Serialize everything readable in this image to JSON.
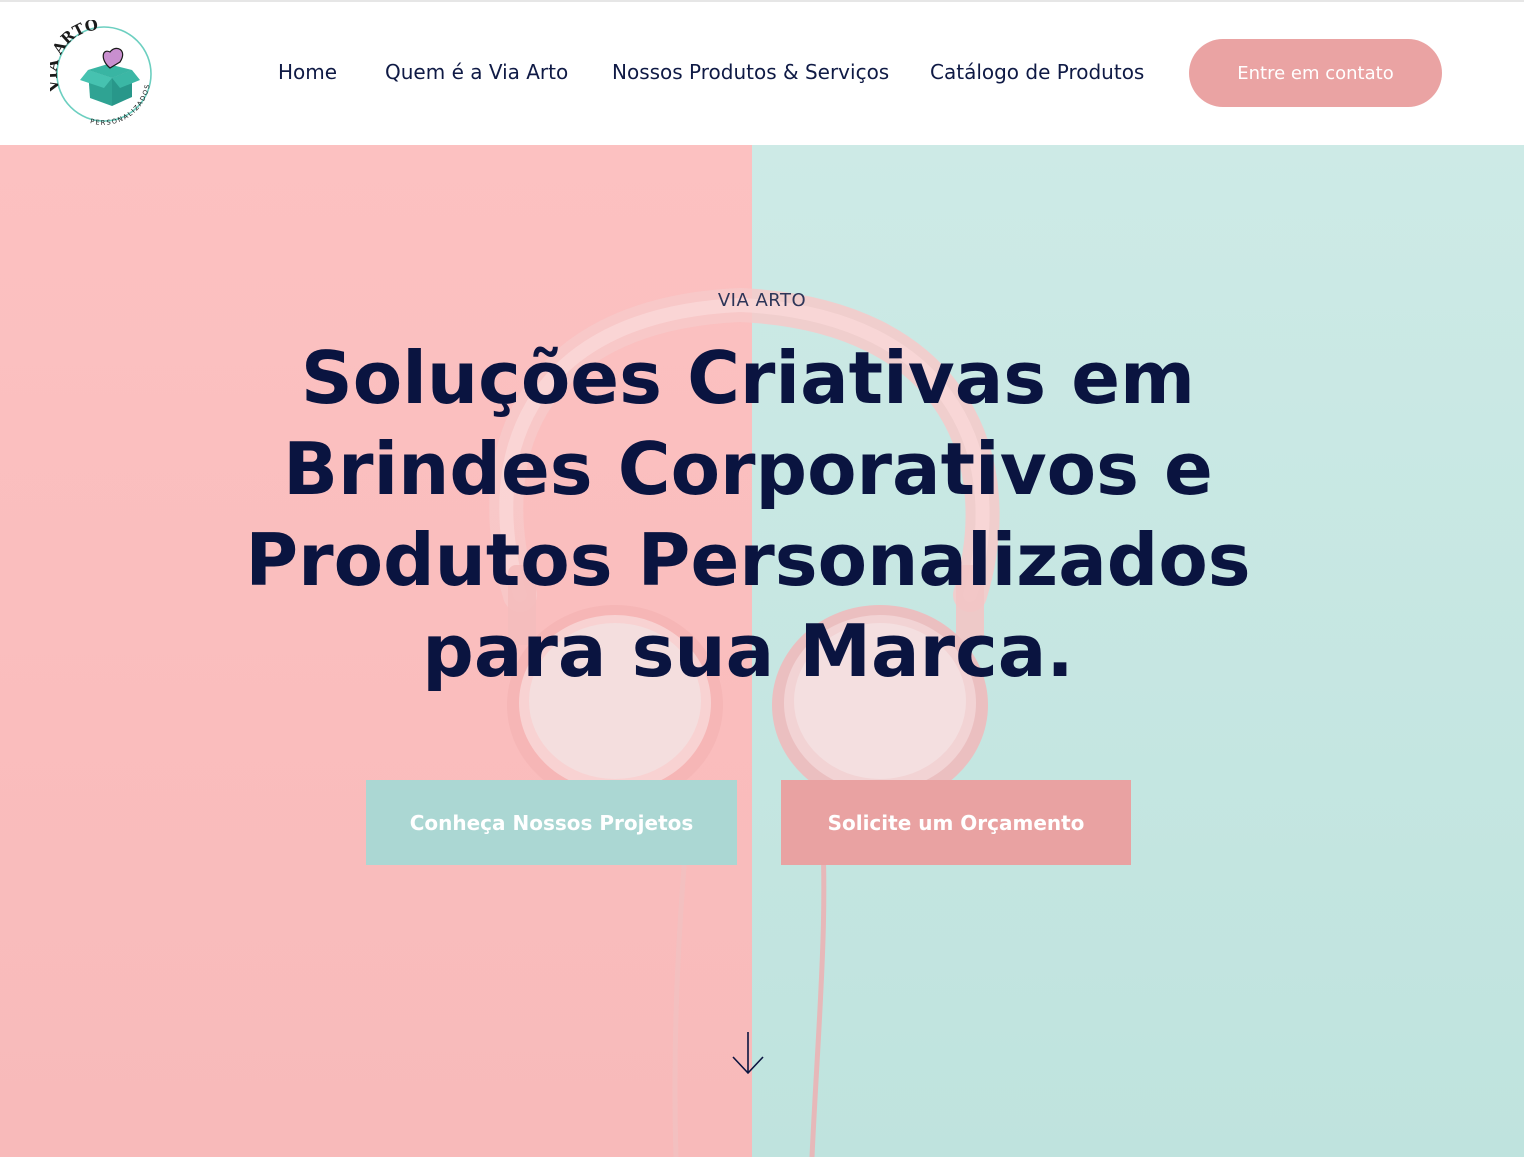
{
  "header": {
    "logo": {
      "text_top": "VIA ARTO",
      "text_bottom": "PERSONALIZADOS"
    },
    "nav": [
      {
        "label": "Home"
      },
      {
        "label": "Quem é a Via Arto"
      },
      {
        "label": "Nossos Produtos & Serviços"
      },
      {
        "label": "Catálogo de Produtos"
      }
    ],
    "cta_label": "Entre em contato"
  },
  "hero": {
    "eyebrow": "VIA ARTO",
    "headline": "Soluções Criativas em Brindes Corporativos e Produtos Personalizados para sua Marca.",
    "buttons": {
      "projects_label": "Conheça Nossos Projetos",
      "quote_label": "Solicite um Orçamento"
    },
    "scroll_icon": "arrow-down-icon"
  },
  "colors": {
    "navy": "#0a1440",
    "pink": "#eaa3a3",
    "teal": "#abd7d3",
    "bg_pink": "#fcc1c1",
    "bg_teal": "#cdeae6"
  }
}
